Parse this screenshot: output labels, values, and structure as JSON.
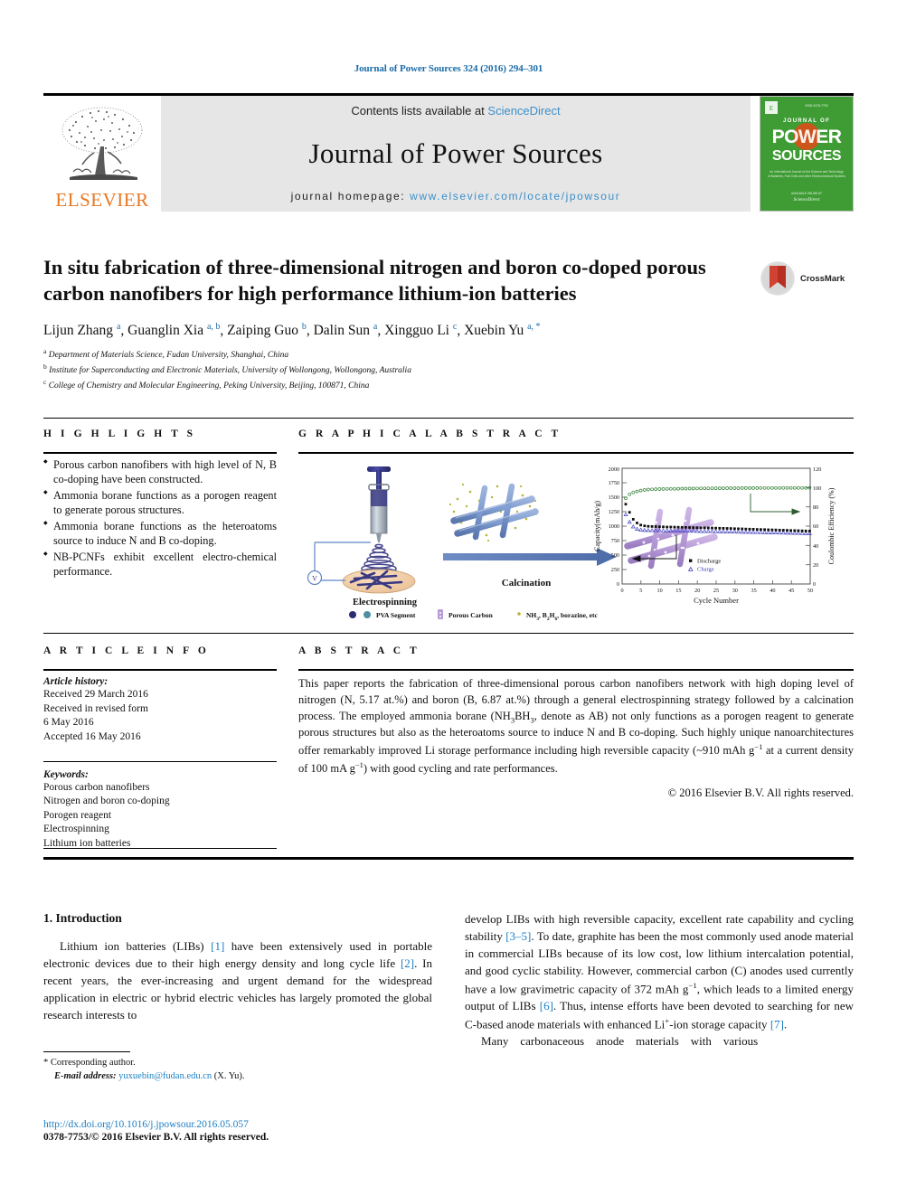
{
  "running_head": "Journal of Power Sources 324 (2016) 294–301",
  "masthead": {
    "publisher_name": "ELSEVIER",
    "contents_prefix": "Contents lists available at ",
    "contents_link": "ScienceDirect",
    "journal_title": "Journal of Power Sources",
    "homepage_prefix": "journal homepage: ",
    "homepage_url": "www.elsevier.com/locate/jpowsour",
    "cover": {
      "line1": "JOURNAL OF",
      "line2": "POWER",
      "line3": "SOURCES",
      "blurb": "An International Journal on the Science and Technology of Batteries, Fuel Cells and other Electrochemical Systems",
      "footer1": "AVAILABLE ONLINE AT",
      "footer2": "ScienceDirect",
      "bg_color": "#3f9c35"
    }
  },
  "article": {
    "title": "In situ fabrication of three-dimensional nitrogen and boron co-doped porous carbon nanofibers for high performance lithium-ion batteries",
    "crossmark_label": "CrossMark",
    "authors": [
      {
        "name": "Lijun Zhang",
        "marks": "a"
      },
      {
        "name": "Guanglin Xia",
        "marks": "a, b"
      },
      {
        "name": "Zaiping Guo",
        "marks": "b"
      },
      {
        "name": "Dalin Sun",
        "marks": "a"
      },
      {
        "name": "Xingguo Li",
        "marks": "c"
      },
      {
        "name": "Xuebin Yu",
        "marks": "a, *"
      }
    ],
    "affiliations": [
      {
        "mark": "a",
        "text": "Department of Materials Science, Fudan University, Shanghai, China"
      },
      {
        "mark": "b",
        "text": "Institute for Superconducting and Electronic Materials, University of Wollongong, Wollongong, Australia"
      },
      {
        "mark": "c",
        "text": "College of Chemistry and Molecular Engineering, Peking University, Beijing, 100871, China"
      }
    ]
  },
  "highlights": {
    "heading": "H I G H L I G H T S",
    "items": [
      "Porous carbon nanofibers with high level of N, B co-doping have been constructed.",
      "Ammonia borane functions as a porogen reagent to generate porous structures.",
      "Ammonia borane functions as the heteroatoms source to induce N and B co-doping.",
      "NB-PCNFs exhibit excellent electro-chemical performance."
    ]
  },
  "graphical_abstract": {
    "heading": "G R A P H I C A L   A B S T R A C T",
    "diagram": {
      "step1_label": "Electrospinning",
      "arrow_label": "Calcination",
      "voltage_label": "V",
      "legend": [
        "PVA Segment",
        "Porous Carbon",
        "NH₃, B₂H₆, borazine, etc"
      ]
    }
  },
  "chart_data": {
    "type": "scatter",
    "title": "",
    "xlabel": "Cycle Number",
    "ylabel": "Capacity(mAh/g)",
    "y2label": "Coulombic Efficiency (%)",
    "xlim": [
      0,
      50
    ],
    "ylim": [
      0,
      2000
    ],
    "y2lim": [
      0,
      120
    ],
    "xticks": [
      0,
      5,
      10,
      15,
      20,
      25,
      30,
      35,
      40,
      45,
      50
    ],
    "yticks": [
      0,
      250,
      500,
      750,
      1000,
      1250,
      1500,
      1750,
      2000
    ],
    "y2ticks": [
      0,
      20,
      40,
      60,
      80,
      100,
      120
    ],
    "grid": false,
    "legend_position": "inside-bottom-center",
    "series": [
      {
        "name": "Discharge",
        "axis": "left",
        "marker": "filled-square",
        "color": "#000000",
        "x": [
          1,
          2,
          3,
          4,
          5,
          6,
          7,
          8,
          9,
          10,
          11,
          12,
          13,
          14,
          15,
          16,
          17,
          18,
          19,
          20,
          21,
          22,
          23,
          24,
          25,
          26,
          27,
          28,
          29,
          30,
          31,
          32,
          33,
          34,
          35,
          36,
          37,
          38,
          39,
          40,
          41,
          42,
          43,
          44,
          45,
          46,
          47,
          48,
          49,
          50
        ],
        "y": [
          1380,
          1240,
          1120,
          1055,
          1020,
          1005,
          998,
          995,
          993,
          990,
          988,
          986,
          985,
          984,
          983,
          982,
          980,
          979,
          978,
          976,
          975,
          974,
          972,
          971,
          970,
          968,
          967,
          965,
          964,
          962,
          960,
          958,
          956,
          954,
          952,
          950,
          948,
          946,
          944,
          942,
          940,
          938,
          936,
          934,
          932,
          930,
          928,
          926,
          924,
          922
        ]
      },
      {
        "name": "Charge",
        "axis": "left",
        "marker": "open-triangle",
        "color": "#4040c0",
        "x": [
          1,
          2,
          3,
          4,
          5,
          6,
          7,
          8,
          9,
          10,
          11,
          12,
          13,
          14,
          15,
          16,
          17,
          18,
          19,
          20,
          21,
          22,
          23,
          24,
          25,
          26,
          27,
          28,
          29,
          30,
          31,
          32,
          33,
          34,
          35,
          36,
          37,
          38,
          39,
          40,
          41,
          42,
          43,
          44,
          45,
          46,
          47,
          48,
          49,
          50
        ],
        "y": [
          1230,
          1100,
          1020,
          980,
          965,
          960,
          958,
          956,
          955,
          954,
          953,
          952,
          951,
          950,
          949,
          948,
          947,
          946,
          945,
          944,
          942,
          941,
          940,
          938,
          937,
          935,
          934,
          932,
          930,
          928,
          926,
          924,
          922,
          920,
          918,
          916,
          914,
          912,
          910,
          908,
          906,
          904,
          902,
          900,
          898,
          896,
          894,
          892,
          890,
          888
        ]
      },
      {
        "name": "Coulombic Efficiency",
        "axis": "right",
        "marker": "open-circle",
        "color": "#2f7d32",
        "x": [
          1,
          2,
          3,
          4,
          5,
          6,
          7,
          8,
          9,
          10,
          11,
          12,
          13,
          14,
          15,
          16,
          17,
          18,
          19,
          20,
          21,
          22,
          23,
          24,
          25,
          26,
          27,
          28,
          29,
          30,
          31,
          32,
          33,
          34,
          35,
          36,
          37,
          38,
          39,
          40,
          41,
          42,
          43,
          44,
          45,
          46,
          47,
          48,
          49,
          50
        ],
        "y": [
          89,
          93,
          95,
          96,
          97,
          97.5,
          98,
          98.2,
          98.4,
          98.5,
          98.6,
          98.7,
          98.8,
          98.8,
          98.9,
          99,
          99,
          99.1,
          99.1,
          99.2,
          99.2,
          99.3,
          99.3,
          99.3,
          99.4,
          99.4,
          99.4,
          99.5,
          99.5,
          99.5,
          99.5,
          99.6,
          99.6,
          99.6,
          99.6,
          99.6,
          99.7,
          99.7,
          99.7,
          99.7,
          99.7,
          99.7,
          99.8,
          99.8,
          99.8,
          99.8,
          99.8,
          99.8,
          99.8,
          99.9
        ]
      }
    ]
  },
  "article_info": {
    "heading": "A R T I C L E   I N F O",
    "history_label": "Article history:",
    "history": [
      "Received 29 March 2016",
      "Received in revised form",
      "6 May 2016",
      "Accepted 16 May 2016"
    ],
    "keywords_label": "Keywords:",
    "keywords": [
      "Porous carbon nanofibers",
      "Nitrogen and boron co-doping",
      "Porogen reagent",
      "Electrospinning",
      "Lithium ion batteries"
    ]
  },
  "abstract": {
    "heading": "A B S T R A C T",
    "paragraph_html": "This paper reports the fabrication of three-dimensional porous carbon nanofibers network with high doping level of nitrogen (N, 5.17 at.%) and boron (B, 6.87 at.%) through a general electrospinning strategy followed by a calcination process. The employed ammonia borane (NH<sub>3</sub>BH<sub>3</sub>, denote as AB) not only functions as a porogen reagent to generate porous structures but also as the heteroatoms source to induce N and B co-doping. Such highly unique nanoarchitectures offer remarkably improved Li storage performance including high reversible capacity (~910 mAh g<sup>−1</sup> at a current density of 100 mA g<sup>−1</sup>) with good cycling and rate performances.",
    "copyright": "© 2016 Elsevier B.V. All rights reserved."
  },
  "body": {
    "section_heading": "1. Introduction",
    "left_paragraph_html": "Lithium ion batteries (LIBs) <span class=\"ref\">[1]</span> have been extensively used in portable electronic devices due to their high energy density and long cycle life <span class=\"ref\">[2]</span>. In recent years, the ever-increasing and urgent demand for the widespread application in electric or hybrid electric vehicles has largely promoted the global research interests to",
    "right_paragraph_html": "develop LIBs with high reversible capacity, excellent rate capability and cycling stability <span class=\"ref\">[3–5]</span>. To date, graphite has been the most commonly used anode material in commercial LIBs because of its low cost, low lithium intercalation potential, and good cyclic stability. However, commercial carbon (C) anodes used currently have a low gravimetric capacity of 372 mAh g<sup>−1</sup>, which leads to a limited energy output of LIBs <span class=\"ref\">[6]</span>. Thus, intense efforts have been devoted to searching for new C-based anode materials with enhanced Li<sup>+</sup>-ion storage capacity <span class=\"ref\">[7]</span>.",
    "right_paragraph2_html": "Many&nbsp;&nbsp;&nbsp;&nbsp;carbonaceous&nbsp;&nbsp;&nbsp;&nbsp;anode&nbsp;&nbsp;&nbsp;&nbsp;materials&nbsp;&nbsp;&nbsp;&nbsp;with&nbsp;&nbsp;&nbsp;&nbsp;various"
  },
  "footer": {
    "corresponding_marker": "*",
    "corresponding_text": "Corresponding author.",
    "email_label": "E-mail address:",
    "email": "yuxuebin@fudan.edu.cn",
    "email_suffix": "(X. Yu).",
    "doi": "http://dx.doi.org/10.1016/j.jpowsour.2016.05.057",
    "issn_line": "0378-7753/© 2016 Elsevier B.V. All rights reserved."
  }
}
